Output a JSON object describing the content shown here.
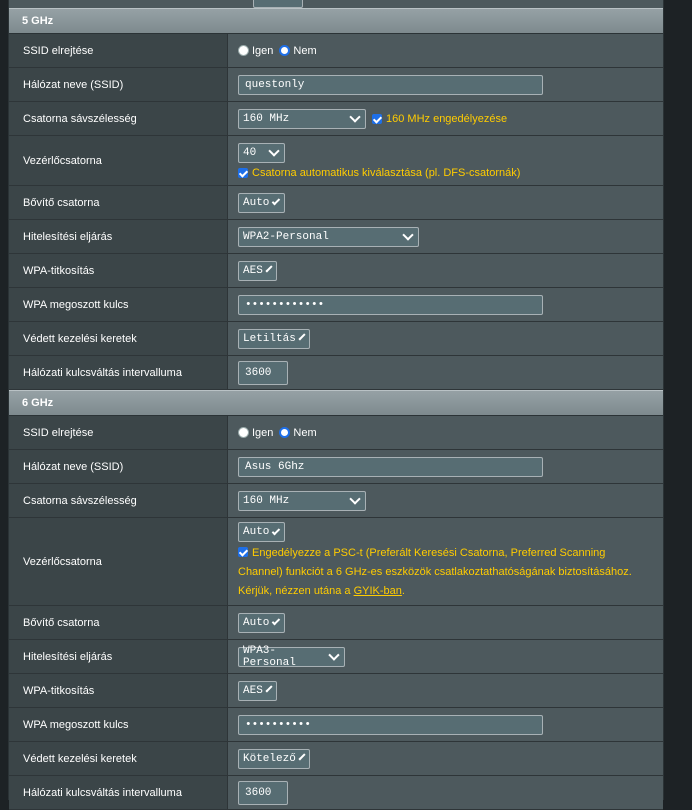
{
  "sections": [
    {
      "title": "5 GHz",
      "ssid_hide": {
        "label": "SSID elrejtése",
        "opt_yes": "Igen",
        "opt_no": "Nem"
      },
      "network_name": {
        "label": "Hálózat neve (SSID)",
        "value": "questonly"
      },
      "bandwidth": {
        "label": "Csatorna sávszélesség",
        "value": "160 MHz",
        "check_label": "160 MHz engedélyezése"
      },
      "control_channel": {
        "label": "Vezérlőcsatorna",
        "value": "40",
        "check_label": "Csatorna automatikus kiválasztása (pl. DFS-csatornák)"
      },
      "ext_channel": {
        "label": "Bővítő csatorna",
        "value": "Auto"
      },
      "auth_method": {
        "label": "Hitelesítési eljárás",
        "value": "WPA2-Personal"
      },
      "wpa_encryption": {
        "label": "WPA-titkosítás",
        "value": "AES"
      },
      "wpa_key": {
        "label": "WPA megoszott kulcs",
        "value": "••••••••••••"
      },
      "pmf": {
        "label": "Védett kezelési keretek",
        "value": "Letiltás"
      },
      "rekey": {
        "label": "Hálózati kulcsváltás intervalluma",
        "value": "3600"
      }
    },
    {
      "title": "6 GHz",
      "ssid_hide": {
        "label": "SSID elrejtése",
        "opt_yes": "Igen",
        "opt_no": "Nem"
      },
      "network_name": {
        "label": "Hálózat neve (SSID)",
        "value": "Asus 6Ghz"
      },
      "bandwidth": {
        "label": "Csatorna sávszélesség",
        "value": "160 MHz"
      },
      "control_channel": {
        "label": "Vezérlőcsatorna",
        "value": "Auto",
        "psc_text": "Engedélyezze a PSC-t (Preferált Keresési Csatorna, Preferred Scanning Channel) funkciót a 6 GHz-es eszközök csatlakoztathatóságának biztosításához. Kérjük, nézzen utána a ",
        "psc_link": "GYIK-ban",
        "psc_tail": "."
      },
      "ext_channel": {
        "label": "Bővítő csatorna",
        "value": "Auto"
      },
      "auth_method": {
        "label": "Hitelesítési eljárás",
        "value": "WPA3-Personal"
      },
      "wpa_encryption": {
        "label": "WPA-titkosítás",
        "value": "AES"
      },
      "wpa_key": {
        "label": "WPA megoszott kulcs",
        "value": "••••••••••"
      },
      "pmf": {
        "label": "Védett kezelési keretek",
        "value": "Kötelező"
      },
      "rekey": {
        "label": "Hálózati kulcsváltás intervalluma",
        "value": "3600"
      }
    }
  ]
}
